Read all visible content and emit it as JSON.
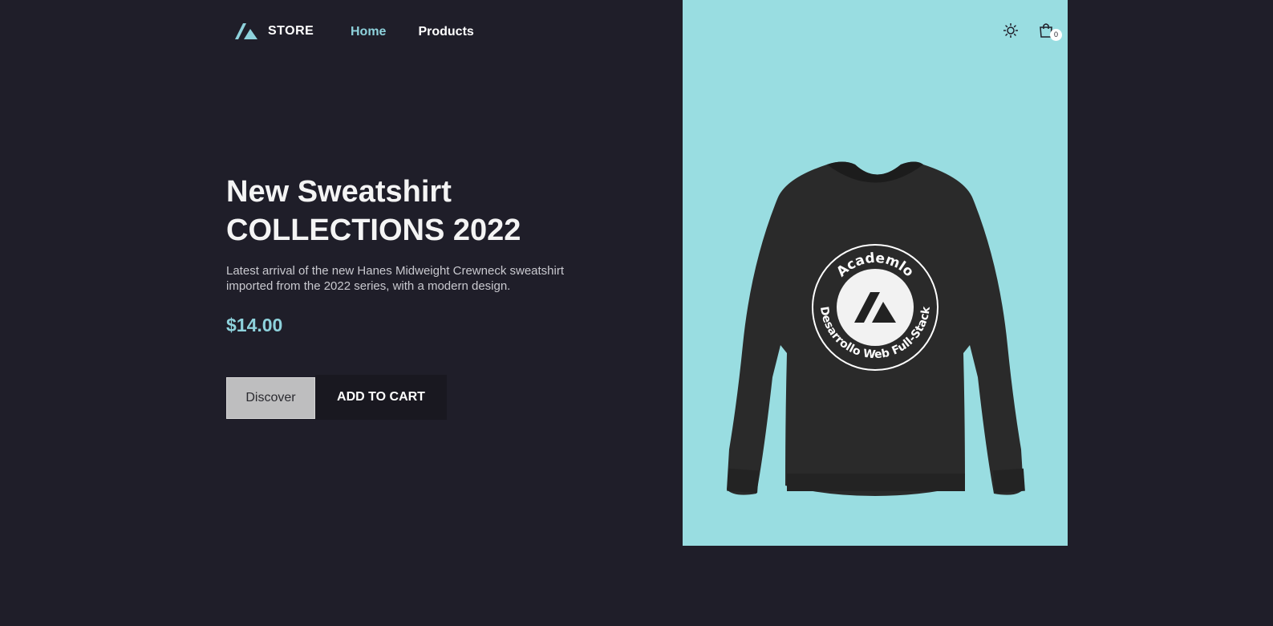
{
  "header": {
    "brand": "STORE",
    "nav": [
      {
        "label": "Home",
        "active": true
      },
      {
        "label": "Products",
        "active": false
      }
    ],
    "cart_count": "0"
  },
  "hero": {
    "title_line1": "New Sweatshirt",
    "title_line2": "COLLECTIONS 2022",
    "description": "Latest arrival of the new Hanes Midweight Crewneck sweatshirt imported from the 2022 series, with a modern design.",
    "price": "$14.00",
    "discover_label": "Discover",
    "add_to_cart_label": "ADD TO CART"
  },
  "product_image": {
    "logo_top_text": "Academlo",
    "logo_bottom_text": "Desarrollo Web Full-Stack"
  },
  "colors": {
    "background": "#1f1e29",
    "accent": "#8ed2dc",
    "panel": "#99dde1"
  },
  "icons": [
    "brand-logo-icon",
    "sun-icon",
    "shopping-bag-icon"
  ]
}
